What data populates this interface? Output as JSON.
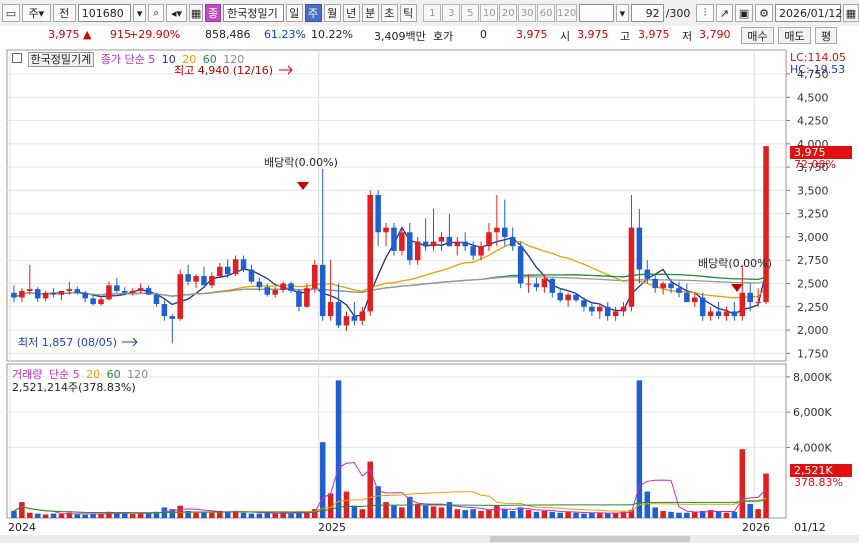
{
  "toolbar": {
    "market_label": "주",
    "type_label": "전",
    "stock_code": "101680",
    "search_badge": "종",
    "stock_name": "한국정밀기",
    "period_tabs": [
      "일",
      "주",
      "월",
      "년",
      "분",
      "초",
      "틱"
    ],
    "selected_period": "주",
    "count_buttons": [
      "1",
      "3",
      "5",
      "10",
      "20",
      "30",
      "60",
      "120"
    ],
    "bar_count": "92",
    "bar_total": "/300",
    "date": "2026/01/12"
  },
  "quote": {
    "price": "3,975",
    "change": "915",
    "change_pct": "+29.90%",
    "volume": "858,486",
    "volume_ratio": "61.23%",
    "turnover": "10.22%",
    "amount": "3,409백만",
    "hoga_label": "호가",
    "hoga_value": "0",
    "hoga_price": "3,975",
    "open_label": "시",
    "open": "3,975",
    "high_label": "고",
    "high": "3,975",
    "low_label": "저",
    "low": "3,790",
    "buy_label": "매수",
    "sell_label": "매도",
    "eval_label": "평"
  },
  "price_legend": {
    "name": "한국정밀기계",
    "ma_label": "종가 단순",
    "periods": [
      "5",
      "10",
      "20",
      "60",
      "120"
    ],
    "lc": "LC:114.05",
    "hc": "HC:-19.53"
  },
  "volume_legend": {
    "title": "거래량",
    "ma_label": "단순",
    "periods": [
      "5",
      "20",
      "60",
      "120"
    ],
    "current": "2,521,214주(378.83%)"
  },
  "annotations": {
    "high": "최고 4,940 (12/16)",
    "low": "최저 1,857 (08/05)",
    "dividend1": "배당락(0.00%)",
    "dividend2": "배당락(0.00%)"
  },
  "price_axis": {
    "ticks": [
      "4,750",
      "4,500",
      "4,250",
      "4,000",
      "3,750",
      "3,500",
      "3,250",
      "3,000",
      "2,750",
      "2,500",
      "2,250",
      "2,000",
      "1,750"
    ],
    "current_tag": "3,975",
    "current_pct": "72.08%"
  },
  "volume_axis": {
    "ticks": [
      "8,000K",
      "6,000K",
      "4,000K"
    ],
    "current_tag": "2,521K",
    "current_pct": "378.83%"
  },
  "x_axis": {
    "labels": [
      "2024",
      "2025",
      "2026",
      "01/12"
    ]
  },
  "colors": {
    "up": "#e02020",
    "down": "#1f5fd0",
    "ma5": "#1c2f9a",
    "ma20": "#e8a000",
    "ma60": "#1f8a3a",
    "ma120": "#9a9a9a",
    "vol_ma5": "#c030c0"
  },
  "chart_data": {
    "type": "candlestick",
    "x_range": [
      "2023-12",
      "2026-01-12"
    ],
    "price_ylim": [
      1700,
      4900
    ],
    "volume_ylim": [
      0,
      8500
    ],
    "candles": [
      [
        2400,
        2480,
        2300,
        2350
      ],
      [
        2350,
        2450,
        2300,
        2420
      ],
      [
        2420,
        2700,
        2380,
        2440
      ],
      [
        2440,
        2460,
        2300,
        2340
      ],
      [
        2340,
        2420,
        2310,
        2400
      ],
      [
        2400,
        2450,
        2350,
        2380
      ],
      [
        2380,
        2420,
        2320,
        2420
      ],
      [
        2420,
        2520,
        2380,
        2440
      ],
      [
        2440,
        2470,
        2380,
        2400
      ],
      [
        2400,
        2420,
        2300,
        2340
      ],
      [
        2340,
        2380,
        2260,
        2280
      ],
      [
        2280,
        2350,
        2260,
        2330
      ],
      [
        2330,
        2520,
        2320,
        2480
      ],
      [
        2480,
        2560,
        2400,
        2420
      ],
      [
        2420,
        2460,
        2380,
        2400
      ],
      [
        2400,
        2450,
        2370,
        2420
      ],
      [
        2420,
        2500,
        2400,
        2450
      ],
      [
        2450,
        2480,
        2380,
        2380
      ],
      [
        2380,
        2400,
        2250,
        2280
      ],
      [
        2280,
        2320,
        2100,
        2150
      ],
      [
        2150,
        2170,
        1857,
        2120
      ],
      [
        2120,
        2650,
        2100,
        2600
      ],
      [
        2600,
        2700,
        2480,
        2520
      ],
      [
        2520,
        2600,
        2450,
        2580
      ],
      [
        2580,
        2680,
        2500,
        2480
      ],
      [
        2480,
        2620,
        2450,
        2580
      ],
      [
        2580,
        2720,
        2560,
        2680
      ],
      [
        2680,
        2760,
        2560,
        2600
      ],
      [
        2600,
        2800,
        2580,
        2760
      ],
      [
        2760,
        2800,
        2620,
        2650
      ],
      [
        2650,
        2700,
        2500,
        2520
      ],
      [
        2520,
        2560,
        2420,
        2460
      ],
      [
        2460,
        2500,
        2360,
        2380
      ],
      [
        2380,
        2460,
        2350,
        2430
      ],
      [
        2430,
        2520,
        2400,
        2500
      ],
      [
        2500,
        2520,
        2400,
        2420
      ],
      [
        2420,
        2440,
        2200,
        2250
      ],
      [
        2250,
        2500,
        2240,
        2450
      ],
      [
        2450,
        2750,
        2400,
        2700
      ],
      [
        2700,
        3730,
        2100,
        2150
      ],
      [
        2150,
        2750,
        2100,
        2300
      ],
      [
        2300,
        2500,
        2020,
        2050
      ],
      [
        2050,
        2200,
        1990,
        2150
      ],
      [
        2150,
        2300,
        2050,
        2100
      ],
      [
        2100,
        2250,
        2050,
        2200
      ],
      [
        2200,
        3500,
        2150,
        3450
      ],
      [
        3450,
        3500,
        2900,
        3050
      ],
      [
        3050,
        3150,
        2900,
        3100
      ],
      [
        3100,
        3150,
        2800,
        2850
      ],
      [
        2850,
        3100,
        2800,
        3050
      ],
      [
        3050,
        3150,
        2700,
        2750
      ],
      [
        2750,
        3000,
        2700,
        2950
      ],
      [
        2950,
        3200,
        2850,
        2900
      ],
      [
        2900,
        3300,
        2850,
        2950
      ],
      [
        2950,
        3050,
        2850,
        3000
      ],
      [
        3000,
        3250,
        2900,
        2900
      ],
      [
        2900,
        3000,
        2800,
        2950
      ],
      [
        2950,
        3050,
        2850,
        2900
      ],
      [
        2900,
        2950,
        2750,
        2800
      ],
      [
        2800,
        2950,
        2750,
        2900
      ],
      [
        2900,
        3150,
        2850,
        3050
      ],
      [
        3050,
        3450,
        2900,
        3100
      ],
      [
        3100,
        3400,
        2900,
        3000
      ],
      [
        3000,
        3100,
        2850,
        2900
      ],
      [
        2900,
        2950,
        2450,
        2500
      ],
      [
        2500,
        2600,
        2400,
        2500
      ],
      [
        2500,
        2560,
        2420,
        2460
      ],
      [
        2460,
        2600,
        2400,
        2550
      ],
      [
        2550,
        2560,
        2350,
        2400
      ],
      [
        2400,
        2450,
        2300,
        2320
      ],
      [
        2320,
        2400,
        2250,
        2380
      ],
      [
        2380,
        2400,
        2300,
        2320
      ],
      [
        2320,
        2350,
        2200,
        2250
      ],
      [
        2250,
        2300,
        2150,
        2200
      ],
      [
        2200,
        2280,
        2120,
        2250
      ],
      [
        2250,
        2300,
        2100,
        2150
      ],
      [
        2150,
        2250,
        2100,
        2200
      ],
      [
        2200,
        2300,
        2150,
        2250
      ],
      [
        2250,
        3450,
        2200,
        3100
      ],
      [
        3100,
        3300,
        2500,
        2650
      ],
      [
        2650,
        2750,
        2500,
        2550
      ],
      [
        2550,
        2600,
        2400,
        2450
      ],
      [
        2450,
        2520,
        2380,
        2500
      ],
      [
        2500,
        2550,
        2400,
        2450
      ],
      [
        2450,
        2520,
        2350,
        2400
      ],
      [
        2400,
        2500,
        2300,
        2300
      ],
      [
        2300,
        2400,
        2250,
        2350
      ],
      [
        2350,
        2400,
        2100,
        2150
      ],
      [
        2150,
        2250,
        2100,
        2200
      ],
      [
        2200,
        2300,
        2120,
        2150
      ],
      [
        2150,
        2250,
        2100,
        2200
      ],
      [
        2200,
        2300,
        2100,
        2150
      ],
      [
        2150,
        2700,
        2100,
        2400
      ],
      [
        2400,
        2500,
        2200,
        2300
      ],
      [
        2300,
        2450,
        2250,
        2300
      ],
      [
        2300,
        3975,
        2280,
        3975
      ]
    ],
    "volumes": [
      400,
      900,
      300,
      250,
      200,
      250,
      220,
      300,
      200,
      180,
      250,
      200,
      350,
      300,
      250,
      220,
      280,
      300,
      350,
      600,
      500,
      700,
      400,
      300,
      350,
      300,
      400,
      350,
      400,
      300,
      250,
      250,
      300,
      250,
      300,
      250,
      350,
      300,
      500,
      4300,
      1400,
      7800,
      1500,
      700,
      500,
      3200,
      1800,
      900,
      700,
      600,
      1200,
      800,
      700,
      650,
      600,
      900,
      500,
      450,
      500,
      400,
      450,
      700,
      500,
      400,
      600,
      450,
      350,
      400,
      350,
      300,
      350,
      300,
      250,
      300,
      280,
      250,
      300,
      350,
      450,
      7800,
      1500,
      600,
      400,
      350,
      300,
      300,
      350,
      400,
      450,
      350,
      300,
      350,
      3900,
      800,
      500,
      2521
    ]
  }
}
